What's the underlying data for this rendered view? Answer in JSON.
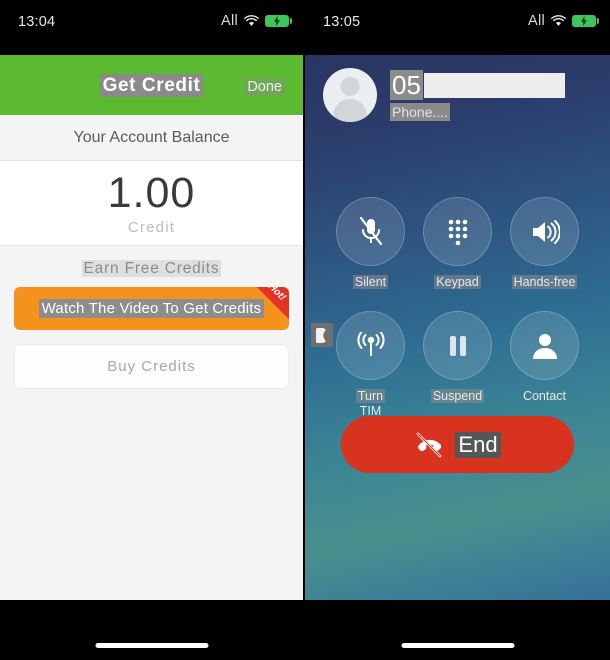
{
  "left_phone": {
    "status_bar": {
      "time": "13:04",
      "carrier_label": "All",
      "wifi_icon": "wifi-icon",
      "battery_icon": "battery-charging-icon"
    },
    "header": {
      "title": "Get Credit",
      "done_label": "Done"
    },
    "balance": {
      "section_label": "Your Account Balance",
      "amount": "1.00",
      "unit": "Credit"
    },
    "earn": {
      "section_title": "Earn Free Credits",
      "video_button_label": "Watch The Video To Get Credits",
      "video_button_badge": "Hot!",
      "buy_button_label": "Buy Credits"
    },
    "colors": {
      "header_green": "#5cba31",
      "video_orange": "#f5921e",
      "badge_red": "#e23329"
    }
  },
  "right_phone": {
    "status_bar": {
      "time": "13:05",
      "carrier_label": "All",
      "wifi_icon": "wifi-icon",
      "battery_icon": "battery-charging-icon"
    },
    "caller": {
      "number_prefix": "05",
      "number_redacted": true,
      "subtitle": "Phone...."
    },
    "controls": [
      {
        "label": "Silent",
        "icon": "microphone-muted-icon",
        "sublabel": ""
      },
      {
        "label": "Keypad",
        "icon": "dialpad-icon",
        "sublabel": ""
      },
      {
        "label": "Hands-free",
        "icon": "speaker-icon",
        "sublabel": ""
      },
      {
        "label": "Turn",
        "icon": "broadcast-antenna-icon",
        "sublabel": "TIM"
      },
      {
        "label": "Suspend",
        "icon": "pause-icon",
        "sublabel": ""
      },
      {
        "label": "Contact",
        "icon": "person-icon",
        "sublabel": ""
      }
    ],
    "badge_icon": "moon-icon",
    "end_button": {
      "label": "End",
      "icon": "end-call-icon",
      "color": "#d8331f"
    }
  }
}
